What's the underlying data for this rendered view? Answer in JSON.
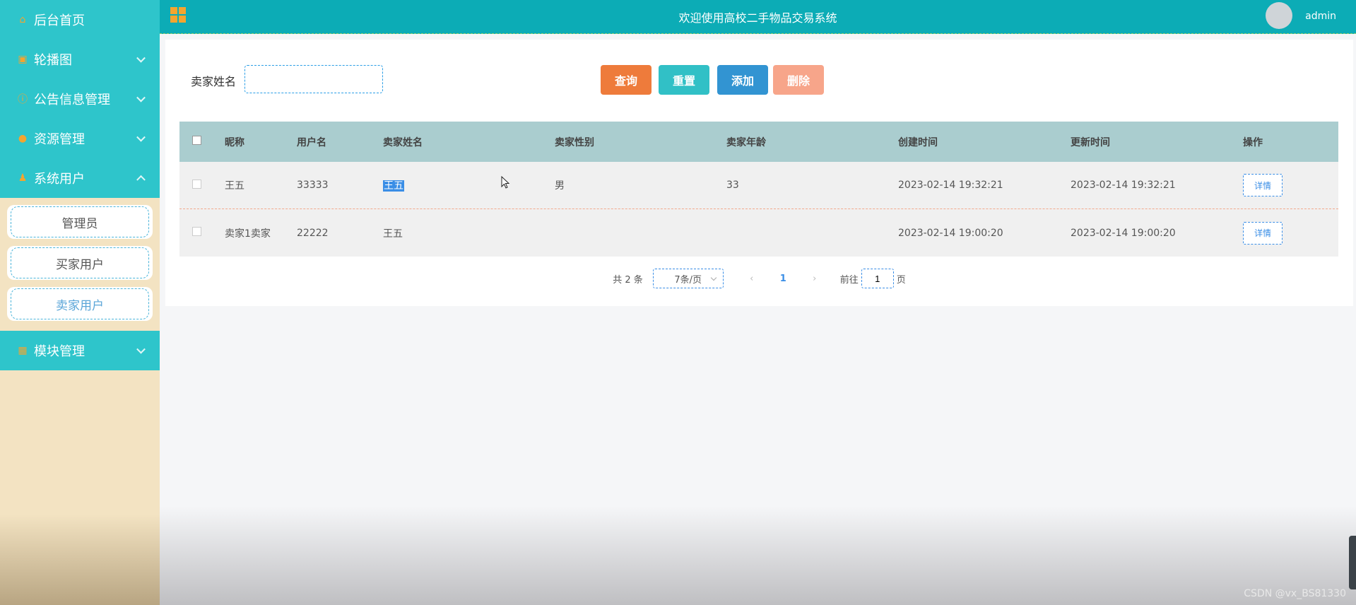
{
  "sidebar": {
    "items": [
      {
        "label": "后台首页",
        "icon": "home-icon"
      },
      {
        "label": "轮播图",
        "icon": "image-icon"
      },
      {
        "label": "公告信息管理",
        "icon": "info-icon"
      },
      {
        "label": "资源管理",
        "icon": "location-icon"
      },
      {
        "label": "系统用户",
        "icon": "user-icon"
      },
      {
        "label": "模块管理",
        "icon": "grid-icon"
      }
    ],
    "subitems": [
      {
        "label": "管理员"
      },
      {
        "label": "买家用户"
      },
      {
        "label": "卖家用户"
      }
    ]
  },
  "header": {
    "title": "欢迎使用高校二手物品交易系统",
    "user": "admin"
  },
  "search": {
    "label": "卖家姓名",
    "value": "",
    "placeholder": ""
  },
  "buttons": {
    "query": "查询",
    "reset": "重置",
    "add": "添加",
    "delete": "删除"
  },
  "table": {
    "headers": [
      "昵称",
      "用户名",
      "卖家姓名",
      "卖家性别",
      "卖家年龄",
      "创建时间",
      "更新时间",
      "操作"
    ],
    "rows": [
      {
        "nick": "王五",
        "user": "33333",
        "seller": "王五",
        "sex": "男",
        "age": "33",
        "created": "2023-02-14 19:32:21",
        "updated": "2023-02-14 19:32:21",
        "op": "详情"
      },
      {
        "nick": "卖家1卖家",
        "user": "22222",
        "seller": "王五",
        "sex": "",
        "age": "",
        "created": "2023-02-14 19:00:20",
        "updated": "2023-02-14 19:00:20",
        "op": "详情"
      }
    ]
  },
  "pager": {
    "total": "共 2 条",
    "page_size": "7条/页",
    "current": "1",
    "goto_label": "前往",
    "goto_value": "1",
    "page_suffix": "页"
  },
  "watermark": "CSDN @vx_BS81330",
  "colors": {
    "header": "#0cacb6",
    "sidebar_active": "#2ec5cb",
    "query": "#ee7b3b",
    "reset": "#31c0c6",
    "add": "#3294d2",
    "delete": "#f7a58a"
  }
}
